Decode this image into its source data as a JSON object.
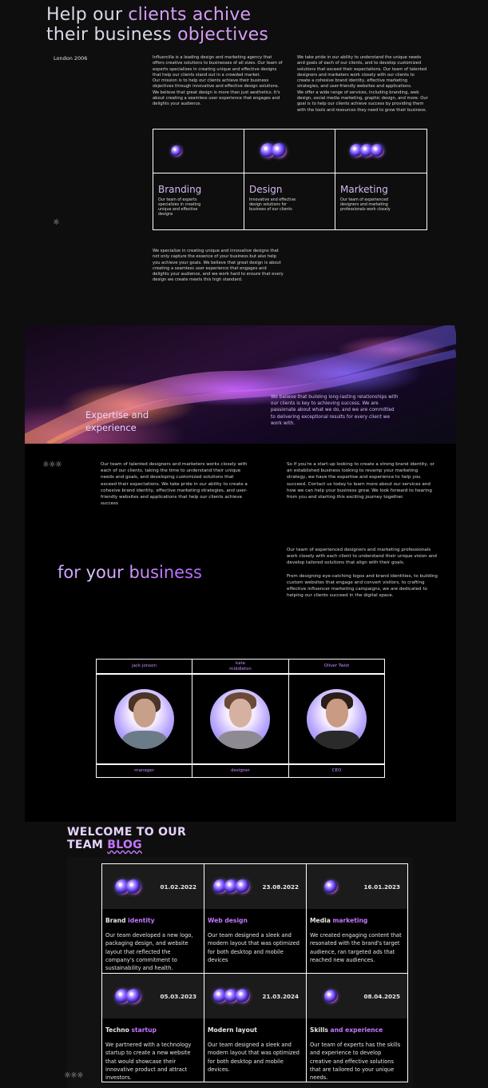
{
  "hero": {
    "headline_1a": "Help our ",
    "headline_1b": "clients achive",
    "headline_2a": "their business ",
    "headline_2b": "objectives",
    "location": "London 2006",
    "intro_left": "Influercilla is a leading design and marketing agency that offers creative solutions to businesses of all sizes. Our team of experts specializes in creating unique and effective designs that help our clients stand out in a crowded market.\nOur mission is to help our clients achieve their business objectives through innovative and effective design solutions. We believe that great design is more than just aesthetics. It's about creating a seamless user experience that engages and delights your audience.",
    "intro_right": "We take pride in our ability to understand the unique needs and goals of each of our clients, and to develop customized solutions that exceed their expectations. Our team of talented designers and marketers work closely with our clients to create a cohesive brand identity, effective marketing strategies, and user-friendly websites and applications.\nWe offer a wide range of services, including branding, web design, social media marketing, graphic design, and more. Our goal is to help our clients achieve success by providing them with the tools and resources they need to grow their business.",
    "outro": "We specialize in creating unique and innovative designs that not only capture the essence of your business but also help you achieve your goals. We believe that great design is about creating a seamless user experience that engages and delights your audience, and we work hard to ensure that every design we create meets this high standard."
  },
  "services": [
    {
      "name": "Branding",
      "desc": "Our team of experts specializes in creating unique and effective designs",
      "orbs": 1
    },
    {
      "name": "Design",
      "desc": "Innovative and effective design solutions for business of our clients",
      "orbs": 2
    },
    {
      "name": "Marketing",
      "desc": "Our team of experienced designers and marketing professionals work closely",
      "orbs": 3
    }
  ],
  "banner": {
    "title_1": "Expertise and",
    "title_2": "experience",
    "text": "We believe that building long-lasting relationships with our clients is key to achieving success. We are passionate about what we do, and we are committed to delivering exceptional results for every client we work with."
  },
  "about": {
    "col_left": "Our team of talented designers and marketers works closely with each of our clients, taking the time to understand their unique needs and goals, and developing customized solutions that exceed their expectations. We take pride in our ability to create a cohesive brand identity, effective marketing strategies, and user-friendly websites and applications that help our clients achieve success",
    "col_right": "So if you're a start-up looking to create a strong brand identity, or an established business looking to revamp your marketing strategy, we have the expertise and experience to help you succeed. Contact us today to learn more about our services and how we can help your business grow. We look forward to hearing from you and starting this exciting journey together.",
    "tagline_a": "for ",
    "tagline_b": "your business",
    "side_text_1": "Our team of experienced designers and marketing professionals work closely with each client to understand their unique vision and develop tailored solutions that align with their goals.",
    "side_text_2": "From designing eye-catching logos and brand identities, to building custom websites that engage and convert visitors, to crafting effective influencer marketing campaigns, we are dedicated to helping our clients succeed in the digital space."
  },
  "team": [
    {
      "name": "jack jonson",
      "role": "manager"
    },
    {
      "name": "kate\nmiddleton",
      "role": "designer"
    },
    {
      "name": "Oliver Twist",
      "role": "CEO"
    }
  ],
  "blog": {
    "title_1": "WELCOME TO OUR",
    "title_2a": "TEAM ",
    "title_2b": "BLOG",
    "posts": [
      {
        "date": "01.02.2022",
        "title_w": "Brand ",
        "title_p": "identity",
        "body": "Our team developed a new logo, packaging design, and website layout that reflected the company's commitment to sustainability and health.",
        "orbs": 2
      },
      {
        "date": "23.08.2022",
        "title_w": "Web design",
        "title_p": "",
        "body": "Our team designed a sleek and modern layout that was optimized for both desktop and mobile devices",
        "orbs": 3
      },
      {
        "date": "16.01.2023",
        "title_w": "Media ",
        "title_p": "marketing",
        "body": "We created engaging content that resonated with the brand's target audience, ran targeted ads that reached new audiences.",
        "orbs": 1
      },
      {
        "date": "05.03.2023",
        "title_w": "Techno ",
        "title_p": "startup",
        "body": "We partnered with a technology startup to create a new website that would showcase their innovative product and attract investors.",
        "orbs": 2
      },
      {
        "date": "21.03.2024",
        "title_w": "Modern layout",
        "title_p": "",
        "body": "Our team designed a sleek and modern layout that was optimized for both desktop and mobile devices.",
        "orbs": 3
      },
      {
        "date": "08.04.2025",
        "title_w": "Skills ",
        "title_p": "and experience",
        "body": "Our team of experts has the skills and experience to develop creative and effective solutions that are tailored to your unique needs.",
        "orbs": 1
      }
    ]
  },
  "icons": {
    "gear": "gear-icon",
    "gear_cluster": "gear-cluster-icon",
    "orb": "orb-icon"
  },
  "colors": {
    "accent": "#c577ff",
    "background": "#0e0e0e",
    "panel": "#000000"
  }
}
